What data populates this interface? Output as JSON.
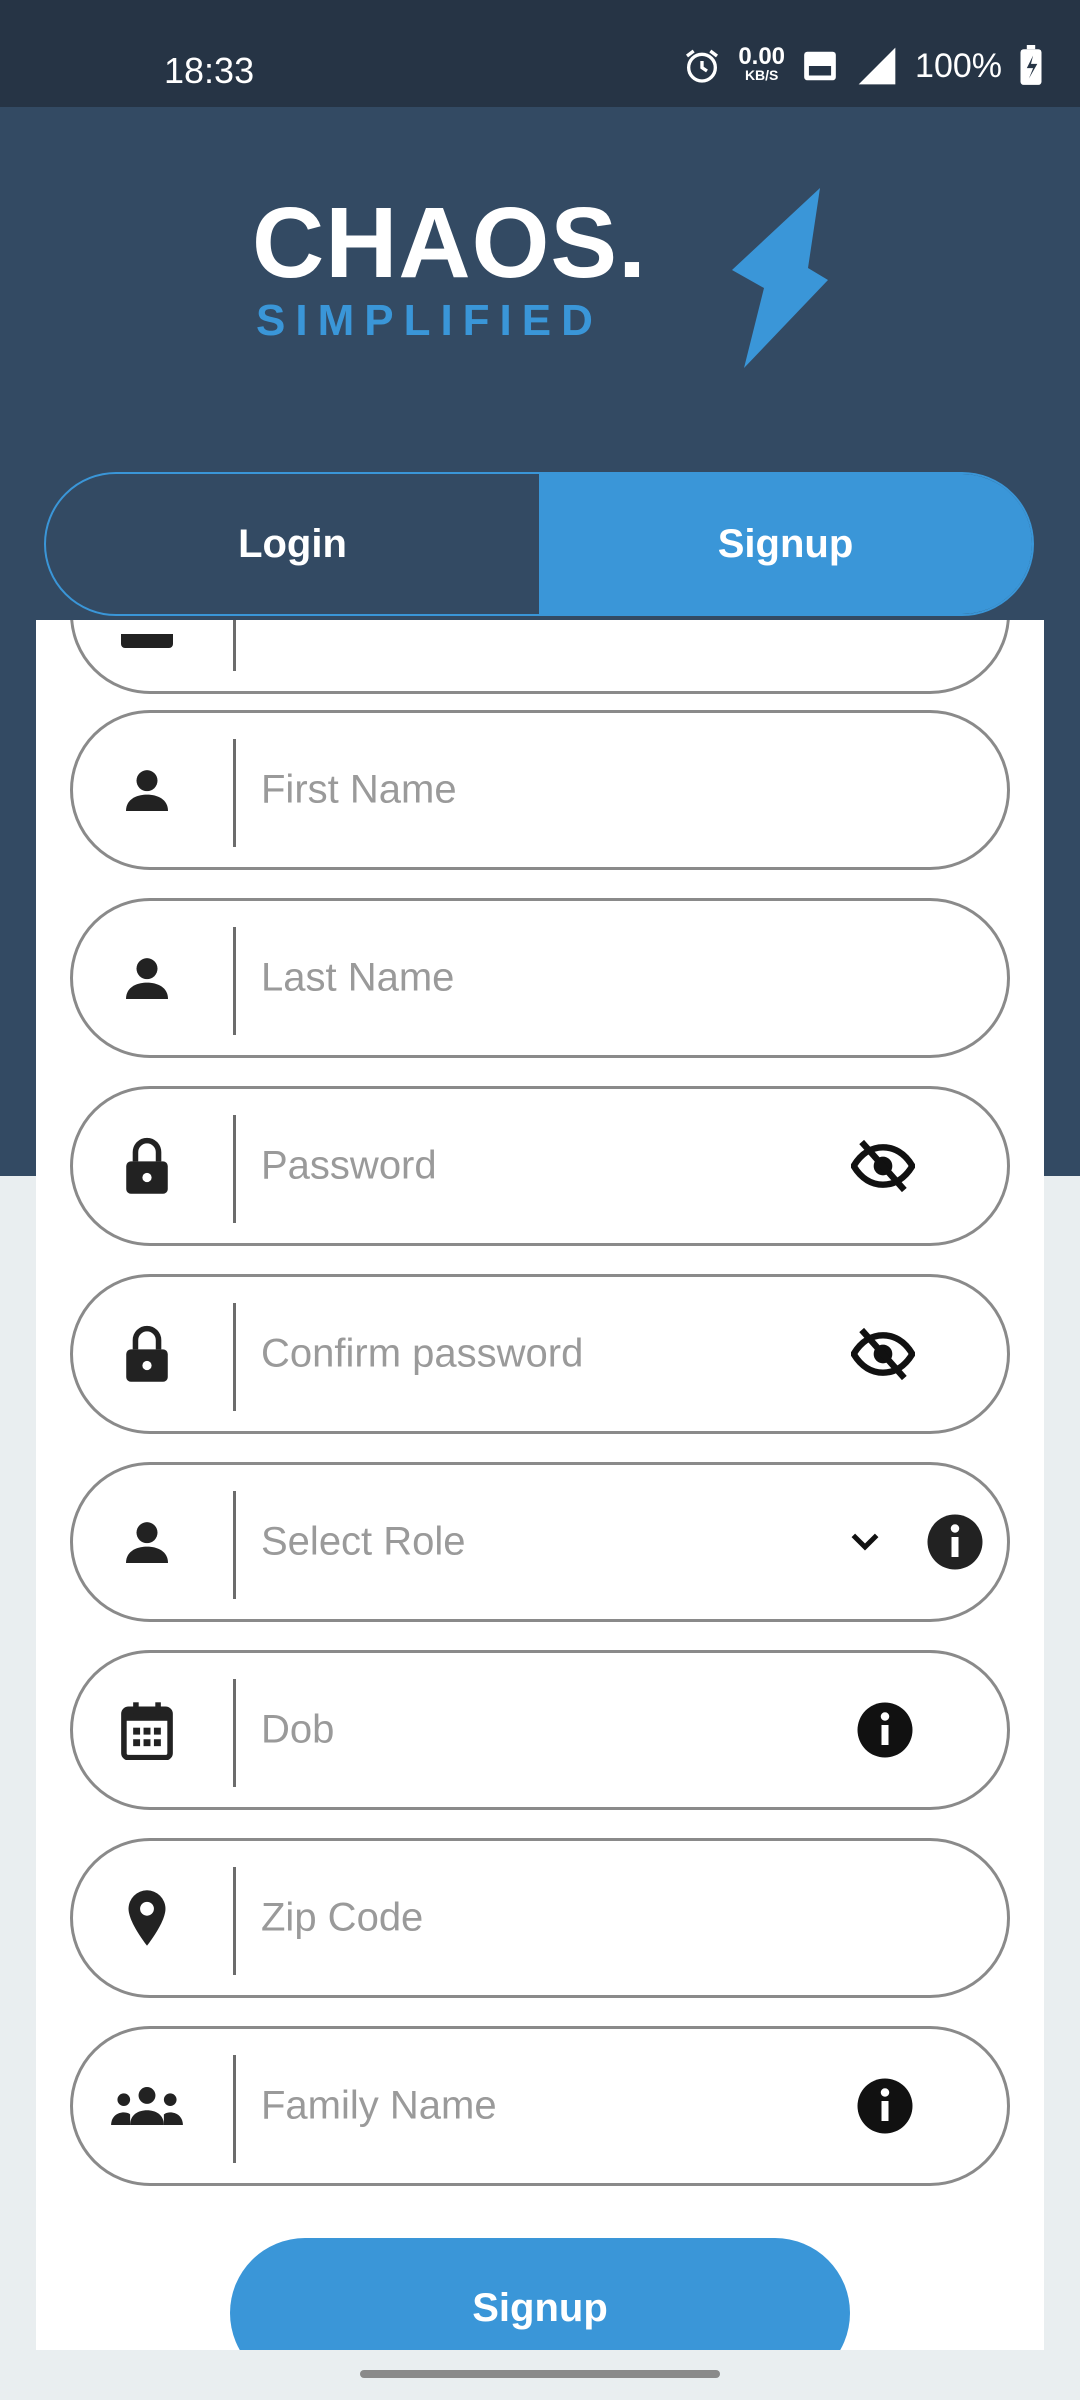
{
  "status": {
    "time": "18:33",
    "net_speed": "0.00",
    "net_unit": "KB/S",
    "battery": "100%"
  },
  "logo": {
    "main": "CHAOS.",
    "sub": "SIMPLIFIED"
  },
  "tabs": [
    {
      "label": "Login",
      "active": false
    },
    {
      "label": "Signup",
      "active": true
    }
  ],
  "fields": {
    "first_name": {
      "placeholder": "First Name",
      "icon": "person-icon"
    },
    "last_name": {
      "placeholder": "Last Name",
      "icon": "person-icon"
    },
    "password": {
      "placeholder": "Password",
      "icon": "lock-icon",
      "trailing": "visibility-off-icon"
    },
    "confirm_password": {
      "placeholder": "Confirm password",
      "icon": "lock-icon",
      "trailing": "visibility-off-icon"
    },
    "role": {
      "placeholder": "Select Role",
      "icon": "person-icon",
      "trailing": [
        "chevron-down-icon",
        "info-icon"
      ]
    },
    "dob": {
      "placeholder": "Dob",
      "icon": "calendar-icon",
      "trailing": "info-icon"
    },
    "zip": {
      "placeholder": "Zip Code",
      "icon": "location-pin-icon"
    },
    "family_name": {
      "placeholder": "Family Name",
      "icon": "group-icon",
      "trailing": "info-icon"
    }
  },
  "submit": {
    "label": "Signup"
  },
  "colors": {
    "header": "#334a63",
    "accent": "#3a96d8",
    "statusbar": "#263445"
  }
}
